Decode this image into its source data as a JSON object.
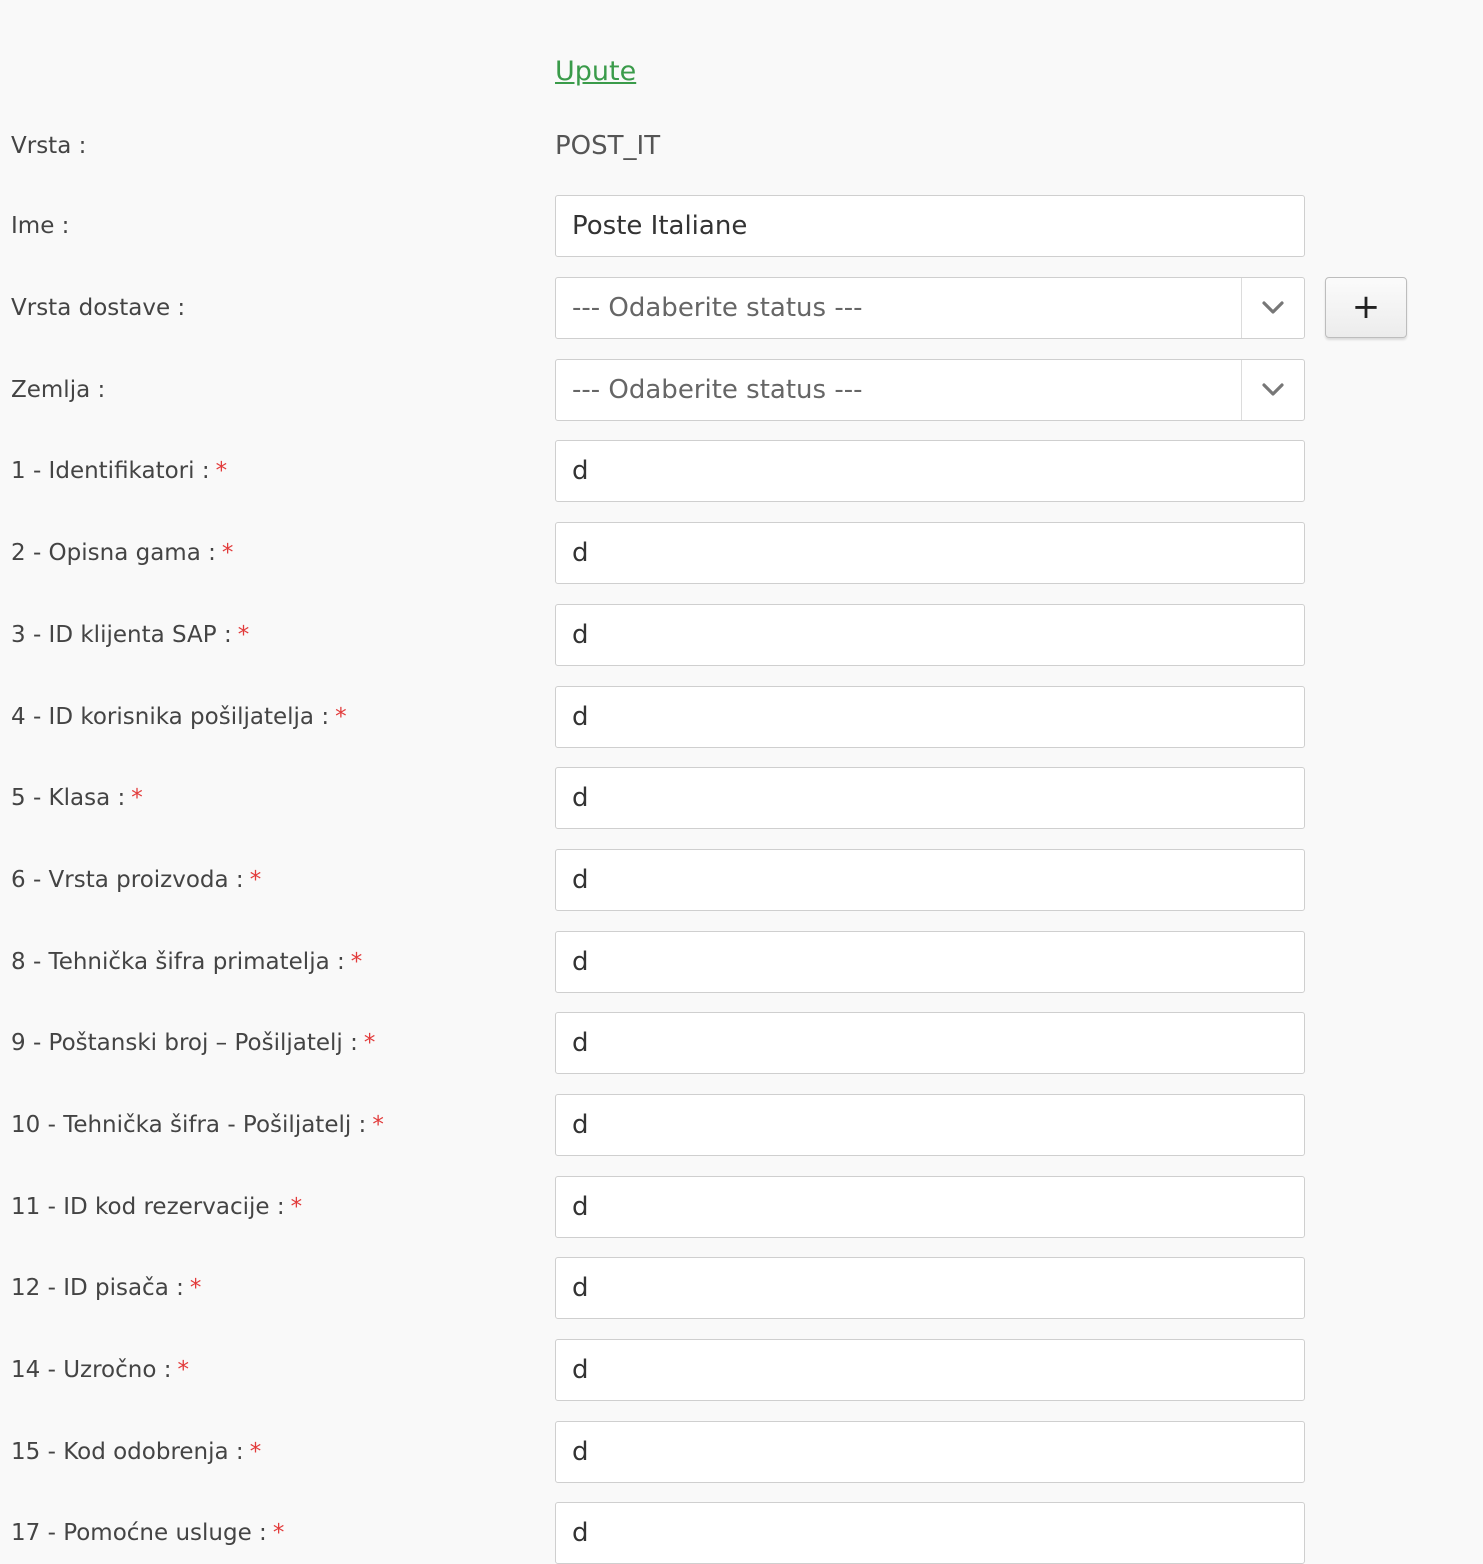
{
  "help_link": "Upute",
  "vrsta": {
    "label": "Vrsta :",
    "value": "POST_IT"
  },
  "ime": {
    "label": "Ime :",
    "value": "Poste Italiane"
  },
  "vrsta_dostave": {
    "label": "Vrsta dostave :",
    "selected": "--- Odaberite status ---",
    "add_button": "+"
  },
  "zemlja": {
    "label": "Zemlja :",
    "selected": "--- Odaberite status ---"
  },
  "required_marker": "*",
  "fields": [
    {
      "label": "1 - Identifikatori :",
      "value": "d"
    },
    {
      "label": "2 - Opisna gama :",
      "value": "d"
    },
    {
      "label": "3 - ID klijenta SAP :",
      "value": "d"
    },
    {
      "label": "4 - ID korisnika pošiljatelja :",
      "value": "d"
    },
    {
      "label": "5 - Klasa :",
      "value": "d"
    },
    {
      "label": "6 - Vrsta proizvoda :",
      "value": "d"
    },
    {
      "label": "8 - Tehnička šifra primatelja :",
      "value": "d"
    },
    {
      "label": "9 - Poštanski broj – Pošiljatelj :",
      "value": "d"
    },
    {
      "label": "10 - Tehnička šifra - Pošiljatelj :",
      "value": "d"
    },
    {
      "label": "11 - ID kod rezervacije :",
      "value": "d"
    },
    {
      "label": "12 - ID pisača :",
      "value": "d"
    },
    {
      "label": "14 - Uzročno :",
      "value": "d"
    },
    {
      "label": "15 - Kod odobrenja :",
      "value": "d"
    },
    {
      "label": "17 - Pomoćne usluge :",
      "value": "d"
    }
  ]
}
